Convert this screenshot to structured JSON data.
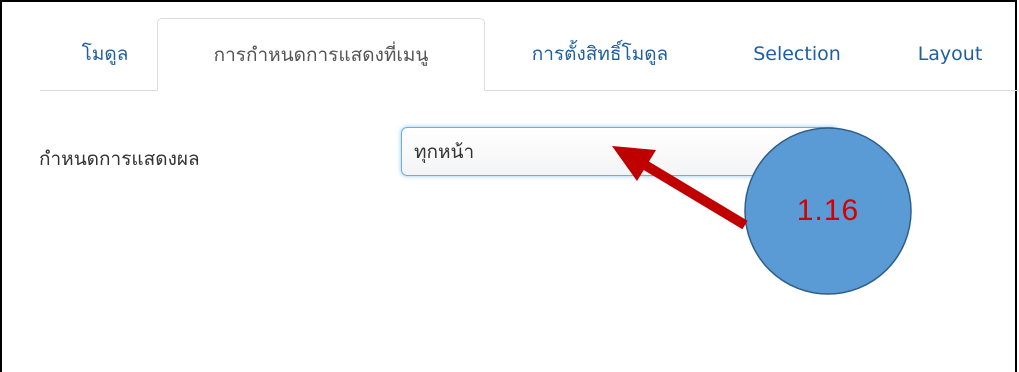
{
  "tabs": [
    {
      "label": "โมดูล",
      "active": false
    },
    {
      "label": "การกำหนดการแสดงที่เมนู",
      "active": true
    },
    {
      "label": "การตั้งสิทธิ์โมดูล",
      "active": false
    },
    {
      "label": "Selection",
      "active": false
    },
    {
      "label": "Layout",
      "active": false
    }
  ],
  "form": {
    "display_label": "กำหนดการแสดงผล",
    "display_value": "ทุกหน้า"
  },
  "annotation": {
    "step_label": "1.16",
    "circle_color": "#5b9bd5",
    "arrow_color": "#c00000",
    "text_color": "#d40000"
  }
}
